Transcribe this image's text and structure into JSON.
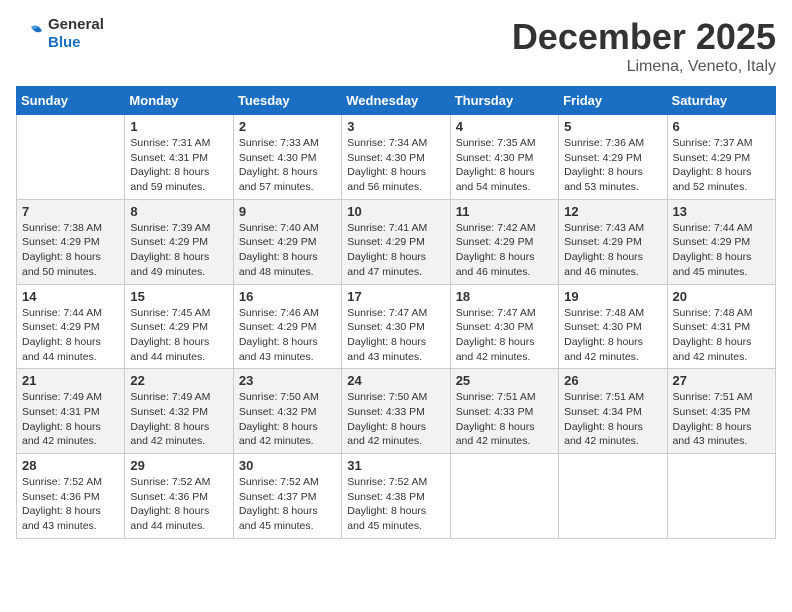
{
  "logo": {
    "general": "General",
    "blue": "Blue"
  },
  "title": "December 2025",
  "location": "Limena, Veneto, Italy",
  "days_header": [
    "Sunday",
    "Monday",
    "Tuesday",
    "Wednesday",
    "Thursday",
    "Friday",
    "Saturday"
  ],
  "weeks": [
    [
      {
        "day": "",
        "sunrise": "",
        "sunset": "",
        "daylight": ""
      },
      {
        "day": "1",
        "sunrise": "Sunrise: 7:31 AM",
        "sunset": "Sunset: 4:31 PM",
        "daylight": "Daylight: 8 hours and 59 minutes."
      },
      {
        "day": "2",
        "sunrise": "Sunrise: 7:33 AM",
        "sunset": "Sunset: 4:30 PM",
        "daylight": "Daylight: 8 hours and 57 minutes."
      },
      {
        "day": "3",
        "sunrise": "Sunrise: 7:34 AM",
        "sunset": "Sunset: 4:30 PM",
        "daylight": "Daylight: 8 hours and 56 minutes."
      },
      {
        "day": "4",
        "sunrise": "Sunrise: 7:35 AM",
        "sunset": "Sunset: 4:30 PM",
        "daylight": "Daylight: 8 hours and 54 minutes."
      },
      {
        "day": "5",
        "sunrise": "Sunrise: 7:36 AM",
        "sunset": "Sunset: 4:29 PM",
        "daylight": "Daylight: 8 hours and 53 minutes."
      },
      {
        "day": "6",
        "sunrise": "Sunrise: 7:37 AM",
        "sunset": "Sunset: 4:29 PM",
        "daylight": "Daylight: 8 hours and 52 minutes."
      }
    ],
    [
      {
        "day": "7",
        "sunrise": "Sunrise: 7:38 AM",
        "sunset": "Sunset: 4:29 PM",
        "daylight": "Daylight: 8 hours and 50 minutes."
      },
      {
        "day": "8",
        "sunrise": "Sunrise: 7:39 AM",
        "sunset": "Sunset: 4:29 PM",
        "daylight": "Daylight: 8 hours and 49 minutes."
      },
      {
        "day": "9",
        "sunrise": "Sunrise: 7:40 AM",
        "sunset": "Sunset: 4:29 PM",
        "daylight": "Daylight: 8 hours and 48 minutes."
      },
      {
        "day": "10",
        "sunrise": "Sunrise: 7:41 AM",
        "sunset": "Sunset: 4:29 PM",
        "daylight": "Daylight: 8 hours and 47 minutes."
      },
      {
        "day": "11",
        "sunrise": "Sunrise: 7:42 AM",
        "sunset": "Sunset: 4:29 PM",
        "daylight": "Daylight: 8 hours and 46 minutes."
      },
      {
        "day": "12",
        "sunrise": "Sunrise: 7:43 AM",
        "sunset": "Sunset: 4:29 PM",
        "daylight": "Daylight: 8 hours and 46 minutes."
      },
      {
        "day": "13",
        "sunrise": "Sunrise: 7:44 AM",
        "sunset": "Sunset: 4:29 PM",
        "daylight": "Daylight: 8 hours and 45 minutes."
      }
    ],
    [
      {
        "day": "14",
        "sunrise": "Sunrise: 7:44 AM",
        "sunset": "Sunset: 4:29 PM",
        "daylight": "Daylight: 8 hours and 44 minutes."
      },
      {
        "day": "15",
        "sunrise": "Sunrise: 7:45 AM",
        "sunset": "Sunset: 4:29 PM",
        "daylight": "Daylight: 8 hours and 44 minutes."
      },
      {
        "day": "16",
        "sunrise": "Sunrise: 7:46 AM",
        "sunset": "Sunset: 4:29 PM",
        "daylight": "Daylight: 8 hours and 43 minutes."
      },
      {
        "day": "17",
        "sunrise": "Sunrise: 7:47 AM",
        "sunset": "Sunset: 4:30 PM",
        "daylight": "Daylight: 8 hours and 43 minutes."
      },
      {
        "day": "18",
        "sunrise": "Sunrise: 7:47 AM",
        "sunset": "Sunset: 4:30 PM",
        "daylight": "Daylight: 8 hours and 42 minutes."
      },
      {
        "day": "19",
        "sunrise": "Sunrise: 7:48 AM",
        "sunset": "Sunset: 4:30 PM",
        "daylight": "Daylight: 8 hours and 42 minutes."
      },
      {
        "day": "20",
        "sunrise": "Sunrise: 7:48 AM",
        "sunset": "Sunset: 4:31 PM",
        "daylight": "Daylight: 8 hours and 42 minutes."
      }
    ],
    [
      {
        "day": "21",
        "sunrise": "Sunrise: 7:49 AM",
        "sunset": "Sunset: 4:31 PM",
        "daylight": "Daylight: 8 hours and 42 minutes."
      },
      {
        "day": "22",
        "sunrise": "Sunrise: 7:49 AM",
        "sunset": "Sunset: 4:32 PM",
        "daylight": "Daylight: 8 hours and 42 minutes."
      },
      {
        "day": "23",
        "sunrise": "Sunrise: 7:50 AM",
        "sunset": "Sunset: 4:32 PM",
        "daylight": "Daylight: 8 hours and 42 minutes."
      },
      {
        "day": "24",
        "sunrise": "Sunrise: 7:50 AM",
        "sunset": "Sunset: 4:33 PM",
        "daylight": "Daylight: 8 hours and 42 minutes."
      },
      {
        "day": "25",
        "sunrise": "Sunrise: 7:51 AM",
        "sunset": "Sunset: 4:33 PM",
        "daylight": "Daylight: 8 hours and 42 minutes."
      },
      {
        "day": "26",
        "sunrise": "Sunrise: 7:51 AM",
        "sunset": "Sunset: 4:34 PM",
        "daylight": "Daylight: 8 hours and 42 minutes."
      },
      {
        "day": "27",
        "sunrise": "Sunrise: 7:51 AM",
        "sunset": "Sunset: 4:35 PM",
        "daylight": "Daylight: 8 hours and 43 minutes."
      }
    ],
    [
      {
        "day": "28",
        "sunrise": "Sunrise: 7:52 AM",
        "sunset": "Sunset: 4:36 PM",
        "daylight": "Daylight: 8 hours and 43 minutes."
      },
      {
        "day": "29",
        "sunrise": "Sunrise: 7:52 AM",
        "sunset": "Sunset: 4:36 PM",
        "daylight": "Daylight: 8 hours and 44 minutes."
      },
      {
        "day": "30",
        "sunrise": "Sunrise: 7:52 AM",
        "sunset": "Sunset: 4:37 PM",
        "daylight": "Daylight: 8 hours and 45 minutes."
      },
      {
        "day": "31",
        "sunrise": "Sunrise: 7:52 AM",
        "sunset": "Sunset: 4:38 PM",
        "daylight": "Daylight: 8 hours and 45 minutes."
      },
      {
        "day": "",
        "sunrise": "",
        "sunset": "",
        "daylight": ""
      },
      {
        "day": "",
        "sunrise": "",
        "sunset": "",
        "daylight": ""
      },
      {
        "day": "",
        "sunrise": "",
        "sunset": "",
        "daylight": ""
      }
    ]
  ]
}
